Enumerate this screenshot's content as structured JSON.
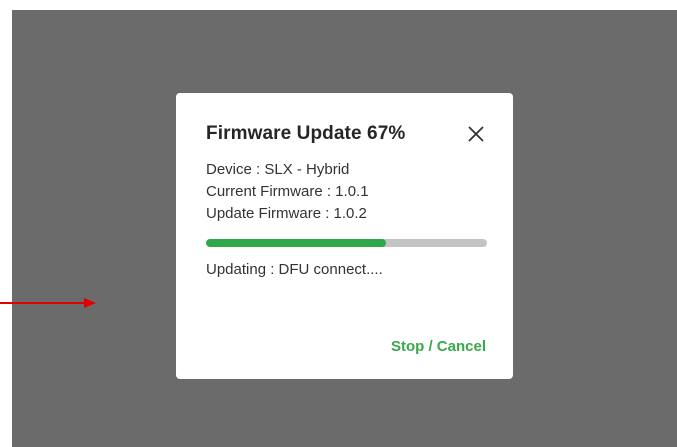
{
  "dialog": {
    "title": "Firmware Update 67%",
    "close_icon": "close-icon",
    "device_line": "Device : SLX - Hybrid",
    "current_firmware_line": "Current Firmware : 1.0.1",
    "update_firmware_line": "Update Firmware : 1.0.2",
    "progress_fraction": 0.64,
    "status_line": "Updating : DFU connect....",
    "stop_cancel_label": "Stop / Cancel"
  },
  "annotation": {
    "icon": "arrow-right-icon",
    "color": "#e00000"
  },
  "colors": {
    "overlay": "#6b6b6b",
    "progress_fill": "#2fa84a",
    "progress_track": "#c4c4c4",
    "action_green": "#3aa84d"
  }
}
